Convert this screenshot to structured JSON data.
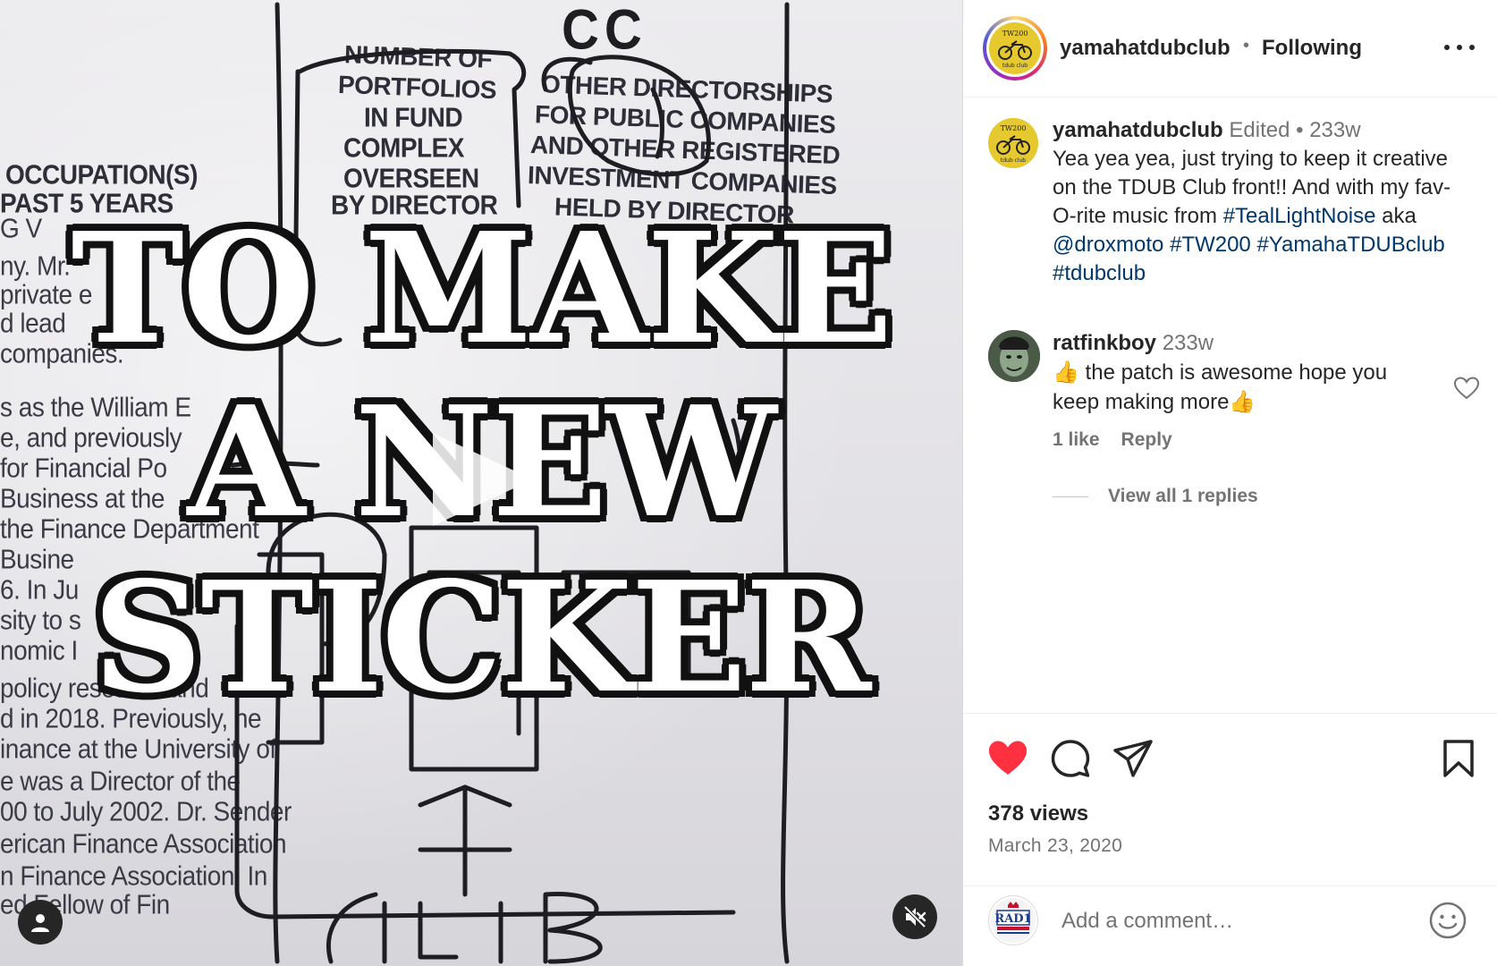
{
  "video": {
    "overlay_lines": [
      "TO MAKE",
      "A NEW",
      "STICKER"
    ],
    "paper_text": {
      "col1": [
        "OCCUPATION(S)",
        "PAST 5 YEARS"
      ],
      "col2": [
        "NUMBER OF",
        "PORTFOLIOS",
        "IN FUND",
        "COMPLEX",
        "OVERSEEN",
        "BY DIRECTOR"
      ],
      "col3": [
        "OTHER DIRECTORSHIPS",
        "FOR PUBLIC COMPANIES",
        "AND OTHER REGISTERED",
        "INVESTMENT COMPANIES",
        "HELD BY DIRECTOR"
      ],
      "body": [
        "G V",
        "ny. Mr.",
        "private e",
        "d lead",
        "companies.",
        "s as the William E",
        "e, and previously",
        "for Financial Po",
        "Business at the",
        "the Finance Department",
        "Busine",
        "6. In Ju",
        "sity to s",
        "nomic I",
        "policy research and",
        "d in 2018. Previously, he",
        "inance at the University of",
        "e was a Director of the",
        "00 to July 2002. Dr. Sender",
        "erican Finance Association",
        "n Finance Association. In",
        "ed Fellow of Fin"
      ]
    },
    "sketch_label_top": "CC",
    "sketch_label_bottom": "CLUB",
    "play_icon": "play-icon",
    "mute_icon": "speaker-muted-icon",
    "tag_icon": "user-tag-icon"
  },
  "header": {
    "username": "yamahatdubclub",
    "separator": "•",
    "follow_status": "Following",
    "more_icon": "more-horizontal-icon"
  },
  "caption": {
    "username": "yamahatdubclub",
    "edited": "Edited",
    "separator": "•",
    "time": "233w",
    "text_plain_1": "Yea yea yea, just trying to keep it creative on the TDUB Club front!! And with my fav-O-rite music from ",
    "tag_1": "#TealLightNoise",
    "text_plain_2": " aka ",
    "tag_2": "@droxmoto",
    "tag_3": "#TW200",
    "tag_4": "#YamahaTDUBclub",
    "tag_5": "#tdubclub"
  },
  "comment": {
    "username": "ratfinkboy",
    "time": "233w",
    "text": "👍 the patch is awesome hope you keep making more👍",
    "likes": "1 like",
    "reply": "Reply",
    "view_replies": "View all 1 replies"
  },
  "actions": {
    "views": "378 views",
    "date": "March 23, 2020",
    "like_color": "#ff3040"
  },
  "add_comment": {
    "placeholder": "Add a comment…",
    "avatar_label": "RAD1"
  },
  "avatar_logo": {
    "top_text": "TW200",
    "bottom_text": "tdub club"
  }
}
